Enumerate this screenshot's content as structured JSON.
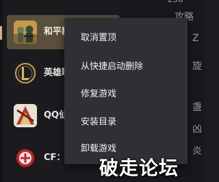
{
  "sidebar": {
    "games": [
      {
        "label": "和平精",
        "icon": "peacekeeper-elite-game-icon",
        "active": true
      },
      {
        "label": "英雄联",
        "icon": "league-of-legends-game-icon",
        "active": false
      },
      {
        "label": "QQ仙",
        "icon": "qq-xian-game-icon",
        "active": false
      },
      {
        "label": "CF：",
        "icon": "crossfire-game-icon",
        "active": false
      }
    ]
  },
  "right_panel": {
    "texts": [
      "250",
      "攻略",
      "Z",
      "旋",
      "盏",
      "凶",
      "炎"
    ]
  },
  "context_menu": {
    "items": [
      "取消置顶",
      "从快捷启动删除",
      "修复游戏",
      "安装目录",
      "卸载游戏"
    ]
  },
  "watermark": {
    "text": "破走论坛"
  },
  "colors": {
    "active_item": "#5a4f3d",
    "menu_bg": "#303034",
    "accent": "#c9b58c"
  }
}
